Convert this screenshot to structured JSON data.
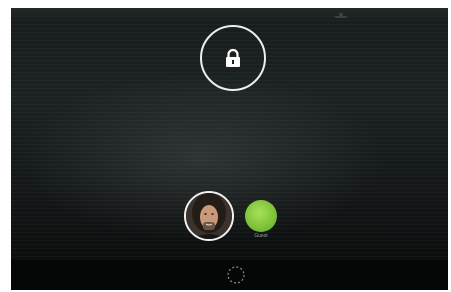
{
  "lock_screen": {
    "guest_label": "Guest"
  },
  "icons": {
    "lock": "lock-icon",
    "spinner": "loading-spinner-icon",
    "guest": "guest-user-icon",
    "boat": "boat-icon"
  },
  "colors": {
    "guest_green": "#7fc43a",
    "ring_white": "#ffffff",
    "background": "#0b0c0c"
  }
}
